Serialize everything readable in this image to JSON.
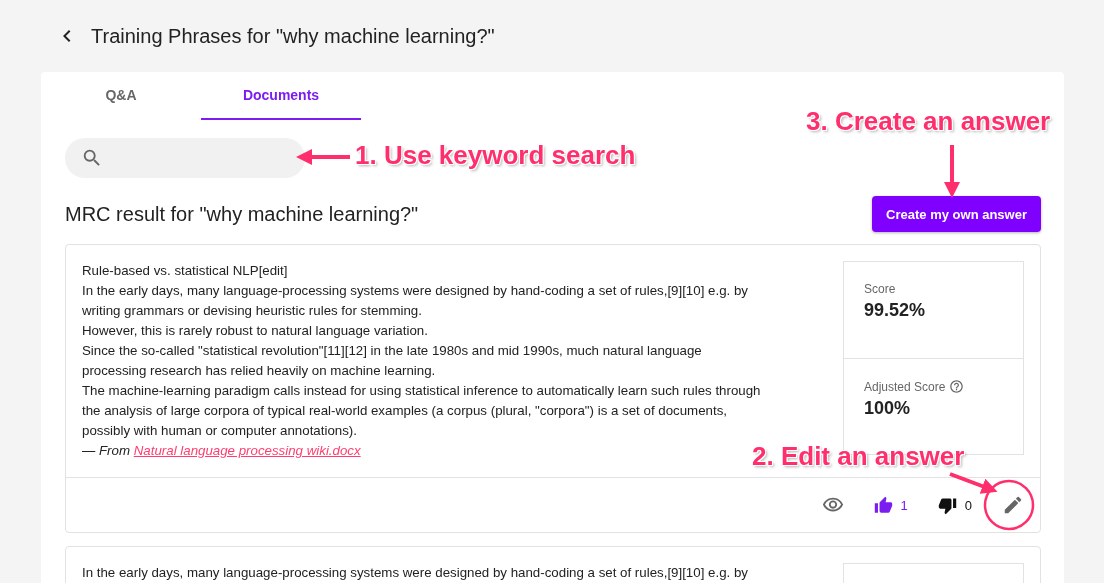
{
  "header": {
    "title": "Training Phrases for \"why machine learning?\""
  },
  "tabs": [
    {
      "label": "Q&A",
      "selected": false
    },
    {
      "label": "Documents",
      "selected": true
    }
  ],
  "result_heading": "MRC result for \"why machine learning?\"",
  "create_button": "Create my own answer",
  "results": [
    {
      "paragraphs": [
        "Rule-based vs. statistical NLP[edit]",
        "In the early days, many language-processing systems were designed by hand-coding a set of rules,[9][10] e.g. by writing grammars or devising heuristic rules for stemming.",
        "However, this is rarely robust to natural language variation.",
        "Since the so-called \"statistical revolution\"[11][12] in the late 1980s and mid 1990s, much natural language processing research has relied heavily on machine learning.",
        "The machine-learning paradigm calls instead for using statistical inference to automatically learn such rules through the analysis of large corpora of typical real-world examples (a corpus (plural, \"corpora\") is a set of documents, possibly with human or computer annotations)."
      ],
      "source_prefix": "— From",
      "source_link": "Natural language processing wiki.docx",
      "score_label": "Score",
      "score": "99.52%",
      "adjusted_label": "Adjusted Score",
      "adjusted_score": "100%",
      "likes": "1",
      "liked": true,
      "dislikes": "0",
      "disliked": false
    },
    {
      "paragraphs": [
        "In the early days, many language-processing systems were designed by hand-coding a set of rules,[9][10] e.g. by"
      ]
    }
  ],
  "annotations": [
    {
      "text": "1. Use keyword search"
    },
    {
      "text": "3. Create an answer"
    },
    {
      "text": "2. Edit an answer"
    }
  ]
}
